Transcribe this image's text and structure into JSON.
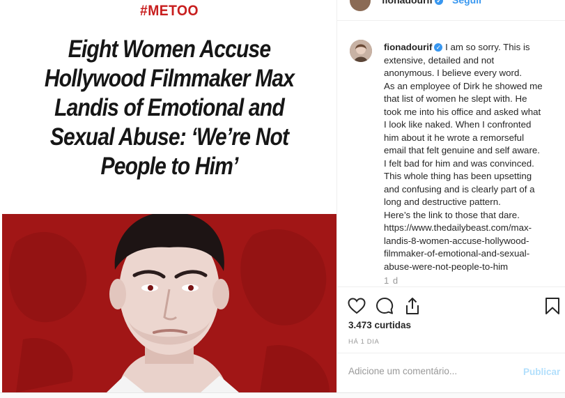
{
  "post_image": {
    "tag": "#METOO",
    "headline_lines": [
      "Eight Women Accuse",
      "Hollywood Filmmaker Max",
      "Landis of Emotional and",
      "Sexual Abuse: ‘We’re Not",
      "People to Him’"
    ]
  },
  "header": {
    "username": "fionadourif",
    "verified_glyph": "✓",
    "follow_label": "Seguir"
  },
  "caption": {
    "username": "fionadourif",
    "lines": [
      " I am so sorry. This is",
      "extensive, detailed and not",
      "anonymous. I believe every word.",
      "As an employee of Dirk he showed me",
      "that list of women he slept with. He",
      "took me into his office and asked what",
      "I look like naked. When I confronted",
      "him about it he wrote a remorseful",
      "email that felt genuine and self aware.",
      "I felt bad for him and was convinced.",
      "This whole thing has been upsetting",
      "and confusing and is clearly part of a",
      "long and destructive pattern.",
      "Here’s the link to those that dare.",
      "https://www.thedailybeast.com/max-",
      "landis-8-women-accuse-hollywood-",
      "filmmaker-of-emotional-and-sexual-",
      "abuse-were-not-people-to-him"
    ],
    "time": "1 d"
  },
  "actions": {
    "icons": [
      "heart-icon",
      "comment-icon",
      "share-icon",
      "bookmark-icon"
    ],
    "likes": "3.473 curtidas",
    "date": "HÁ 1 DIA"
  },
  "comment_box": {
    "placeholder": "Adicione um comentário...",
    "publish_label": "Publicar"
  },
  "colors": {
    "accent": "#3897f0",
    "tag_red": "#c81e1e",
    "photo_red": "#a11616",
    "publish_disabled": "#b2dffc"
  }
}
